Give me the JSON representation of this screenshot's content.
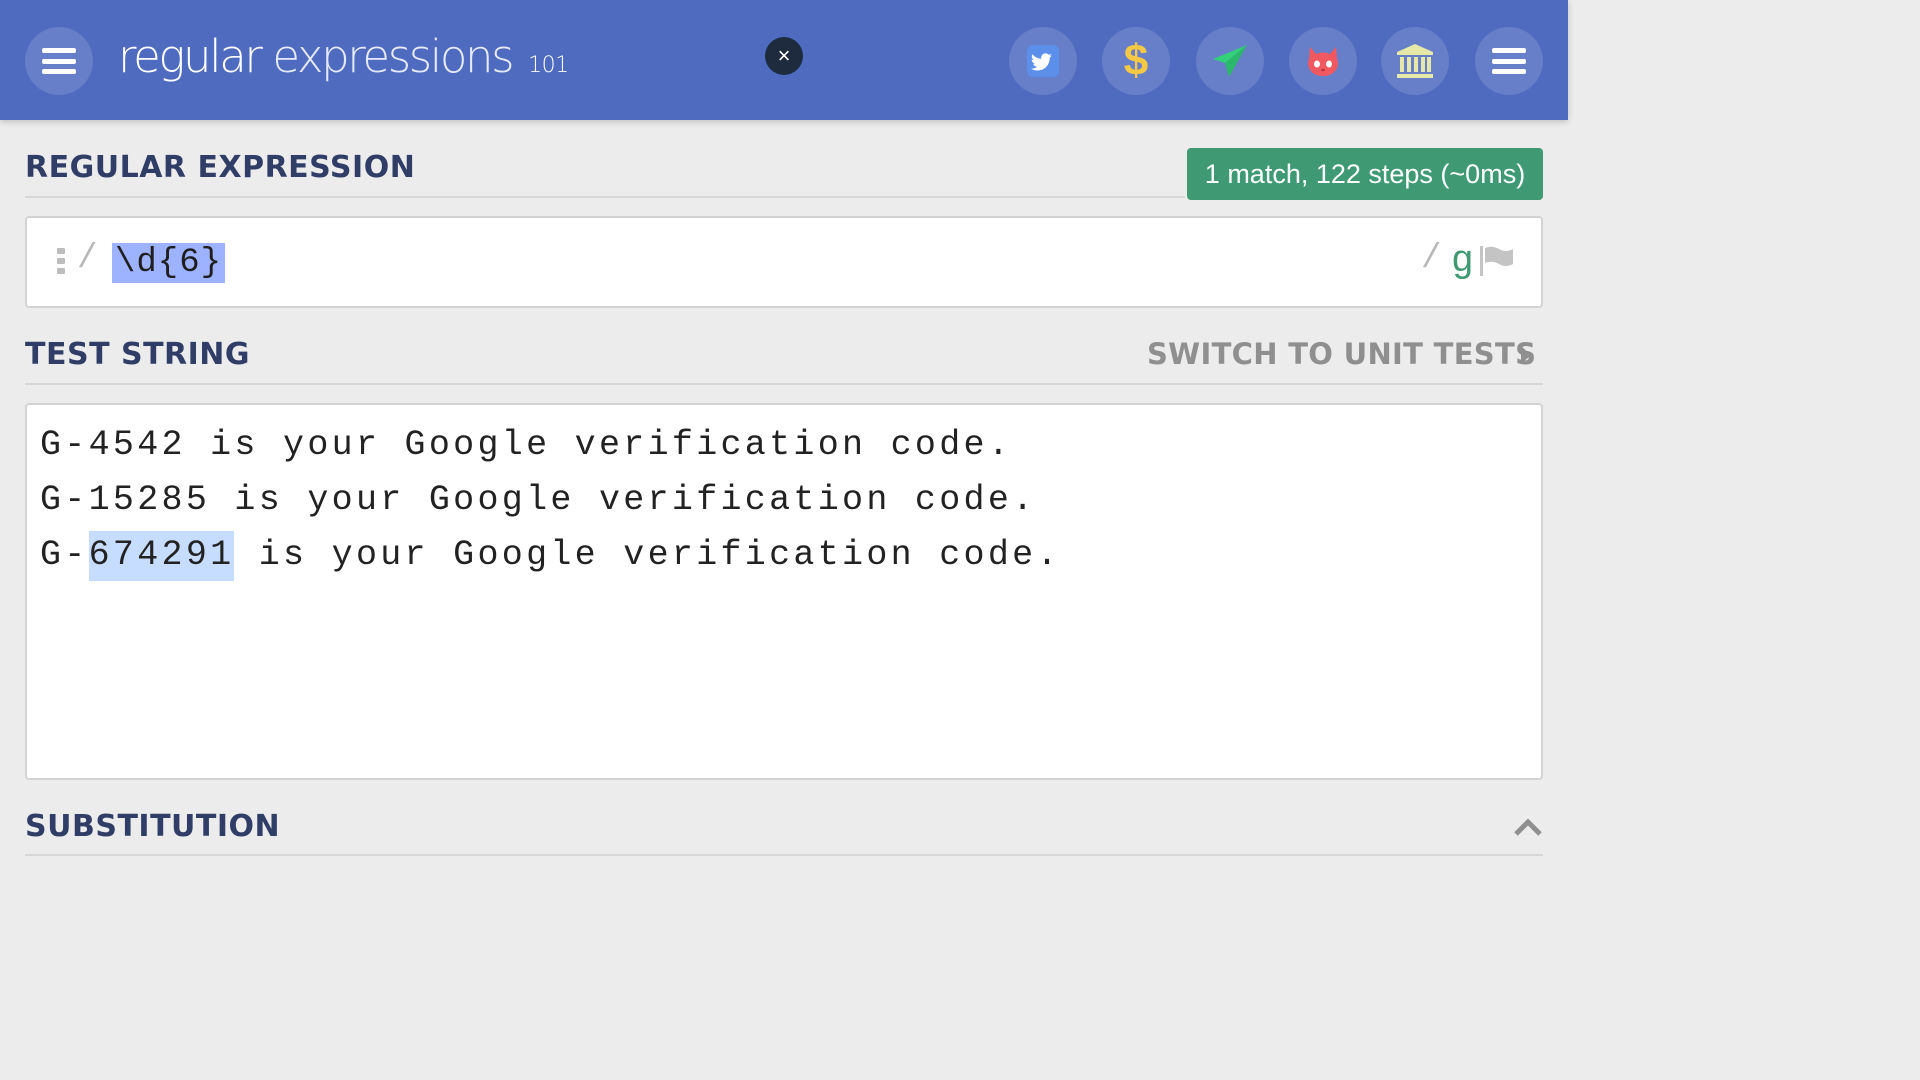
{
  "header": {
    "logo_main": "regular",
    "logo_second": "expressions",
    "logo_version": "101",
    "close_label": "×",
    "colors": {
      "bar": "#4f6bbf",
      "twitter": "#5b8fe9",
      "dollar": "#f6c945",
      "send": "#33d17a",
      "github": "#f2585f",
      "bank": "#e6e8a8"
    },
    "icons": [
      "menu-icon",
      "twitter-icon",
      "dollar-icon",
      "send-icon",
      "github-icon",
      "bank-icon",
      "menu-icon"
    ],
    "dollar_glyph": "$"
  },
  "regex": {
    "title": "REGULAR EXPRESSION",
    "match_info": "1 match, 122 steps (~0ms)",
    "open_delimiter": "/",
    "pattern": "\\d{6}",
    "close_delimiter": "/",
    "flags": "g"
  },
  "test_string": {
    "title": "TEST STRING",
    "switch_label": "SWITCH TO UNIT TESTS",
    "lines": [
      {
        "text": "G-4542 is your Google verification code."
      },
      {
        "text": "G-15285 is your Google verification code."
      },
      {
        "before": "G-",
        "match": "674291",
        "after": " is your Google verification code."
      }
    ]
  },
  "substitution": {
    "title": "SUBSTITUTION"
  }
}
